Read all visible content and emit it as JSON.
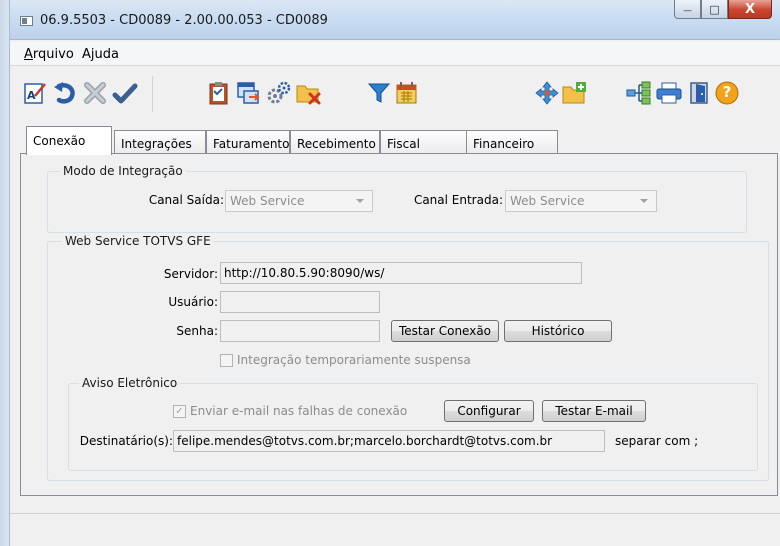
{
  "window": {
    "title": "06.9.5503 - CD0089 - 2.00.00.053 - CD0089",
    "minimize_glyph": "—",
    "maximize_glyph": "□",
    "close_glyph": "X"
  },
  "menu": {
    "items": [
      "Arquivo",
      "Ajuda"
    ]
  },
  "toolbar": {
    "icons": [
      "spellcheck-icon",
      "undo-icon",
      "cancel-icon",
      "confirm-icon",
      "clipboard-icon",
      "window-export-icon",
      "gears-icon",
      "folder-delete-icon",
      "filter-icon",
      "calendar-icon",
      "move-icon",
      "new-folder-icon",
      "tree-icon",
      "print-icon",
      "exit-icon",
      "help-icon"
    ],
    "help_glyph": "?"
  },
  "tabs": [
    {
      "label": "Conexão",
      "active": true
    },
    {
      "label": "Integrações",
      "active": false
    },
    {
      "label": "Faturamento",
      "active": false
    },
    {
      "label": "Recebimento",
      "active": false
    },
    {
      "label": "Fiscal",
      "active": false
    },
    {
      "label": "Financeiro",
      "active": false
    }
  ],
  "modo_integracao": {
    "title": "Modo de Integração",
    "canal_saida_label": "Canal Saída:",
    "canal_saida_value": "Web Service",
    "canal_entrada_label": "Canal Entrada:",
    "canal_entrada_value": "Web Service"
  },
  "web_service": {
    "title": "Web Service TOTVS GFE",
    "servidor_label": "Servidor:",
    "servidor_value": "http://10.80.5.90:8090/ws/",
    "usuario_label": "Usuário:",
    "usuario_value": "",
    "senha_label": "Senha:",
    "senha_value": "",
    "testar_conexao_label": "Testar Conexão",
    "historico_label": "Histórico",
    "suspensa_label": "Integração temporariamente suspensa"
  },
  "aviso": {
    "title": "Aviso Eletrônico",
    "enviar_label": "Enviar e-mail nas falhas de conexão",
    "enviar_checked": true,
    "check_glyph": "✓",
    "configurar_label": "Configurar",
    "testar_email_label": "Testar E-mail",
    "destinatario_label": "Destinatário(s):",
    "destinatario_value": "felipe.mendes@totvs.com.br;marcelo.borchardt@totvs.com.br",
    "separar_label": "separar com ;"
  },
  "colors": {
    "accent_blue": "#2a5ea8",
    "titlebar": "#c9dcf1"
  }
}
